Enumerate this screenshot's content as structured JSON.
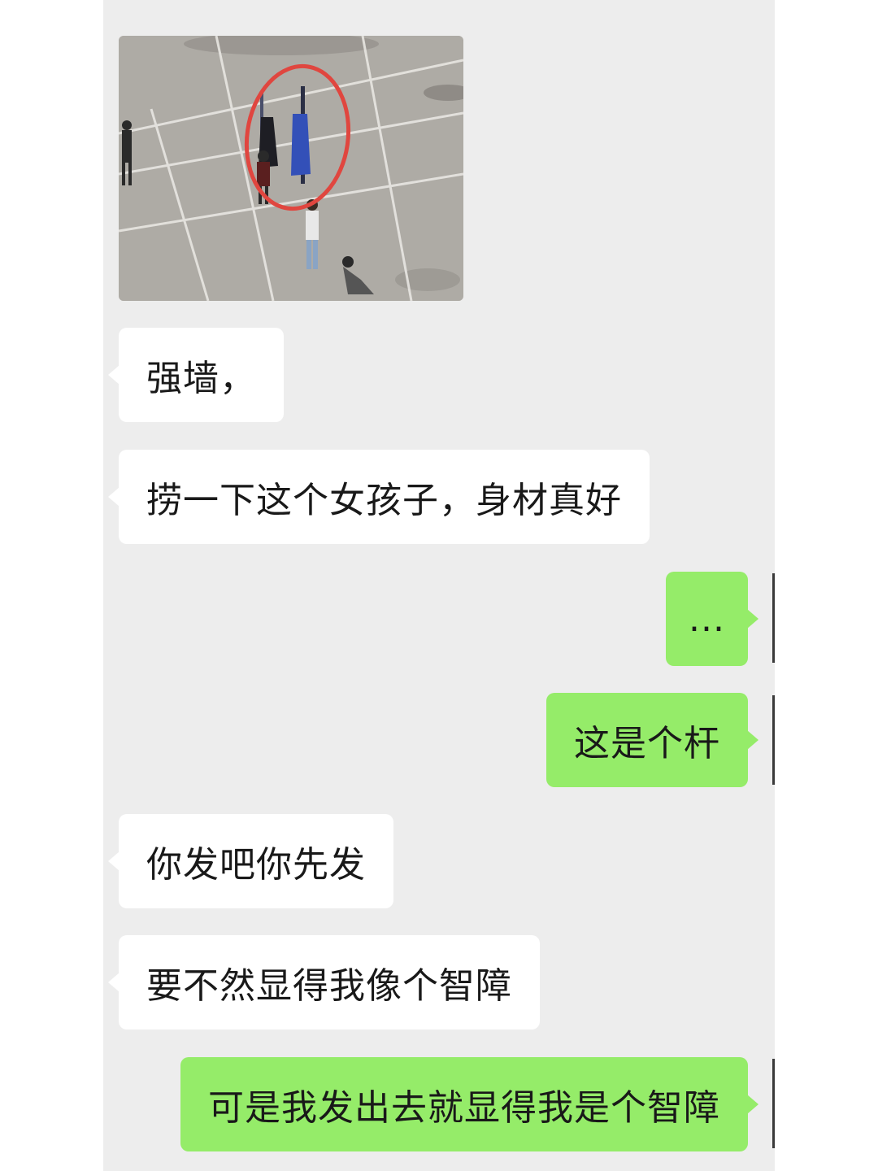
{
  "colors": {
    "panel_background": "#ededed",
    "received_bubble": "#ffffff",
    "sent_bubble": "#95ec69",
    "text": "#191919",
    "circle_annotation": "#e0463f"
  },
  "messages": [
    {
      "side": "received",
      "type": "image",
      "description_icon": "photo-thumbnail"
    },
    {
      "side": "received",
      "type": "text",
      "text": "强墙，"
    },
    {
      "side": "received",
      "type": "text",
      "text": "捞一下这个女孩子，身材真好"
    },
    {
      "side": "sent",
      "type": "text",
      "text": "..."
    },
    {
      "side": "sent",
      "type": "text",
      "text": "这是个杆"
    },
    {
      "side": "received",
      "type": "text",
      "text": "你发吧你先发"
    },
    {
      "side": "received",
      "type": "text",
      "text": "要不然显得我像个智障"
    },
    {
      "side": "sent",
      "type": "text",
      "text": "可是我发出去就显得我是个智障"
    }
  ]
}
